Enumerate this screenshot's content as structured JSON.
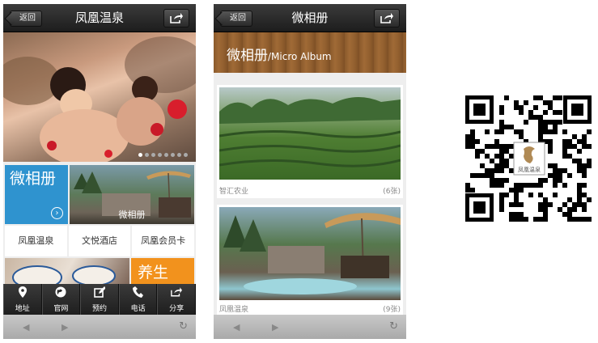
{
  "phone1": {
    "nav": {
      "back": "返回",
      "title": "凤凰温泉"
    },
    "banner": {
      "dots": 8,
      "active_dot": 0
    },
    "album_tile": {
      "label": "微相册"
    },
    "photo_tile": {
      "caption": "微相册"
    },
    "links": [
      "凤凰温泉",
      "文悦酒店",
      "凤凰会员卡"
    ],
    "promo_tile": {
      "label": "养生"
    },
    "tabs": [
      {
        "label": "地址",
        "icon": "location-pin-icon"
      },
      {
        "label": "官网",
        "icon": "globe-icon"
      },
      {
        "label": "预约",
        "icon": "edit-icon"
      },
      {
        "label": "电话",
        "icon": "phone-icon"
      },
      {
        "label": "分享",
        "icon": "share-icon"
      }
    ]
  },
  "phone2": {
    "nav": {
      "back": "返回",
      "title": "微相册"
    },
    "header": {
      "title": "微相册",
      "subtitle": "/Micro Album"
    },
    "albums": [
      {
        "name": "智汇农业",
        "count": "(6张)"
      },
      {
        "name": "凤凰温泉",
        "count": "(9张)"
      }
    ]
  },
  "qr": {
    "logo_text": "凤凰温泉"
  },
  "colors": {
    "album_blue": "#2f93cf",
    "promo_orange": "#f2921d",
    "navbar": "#2a2a2a"
  }
}
